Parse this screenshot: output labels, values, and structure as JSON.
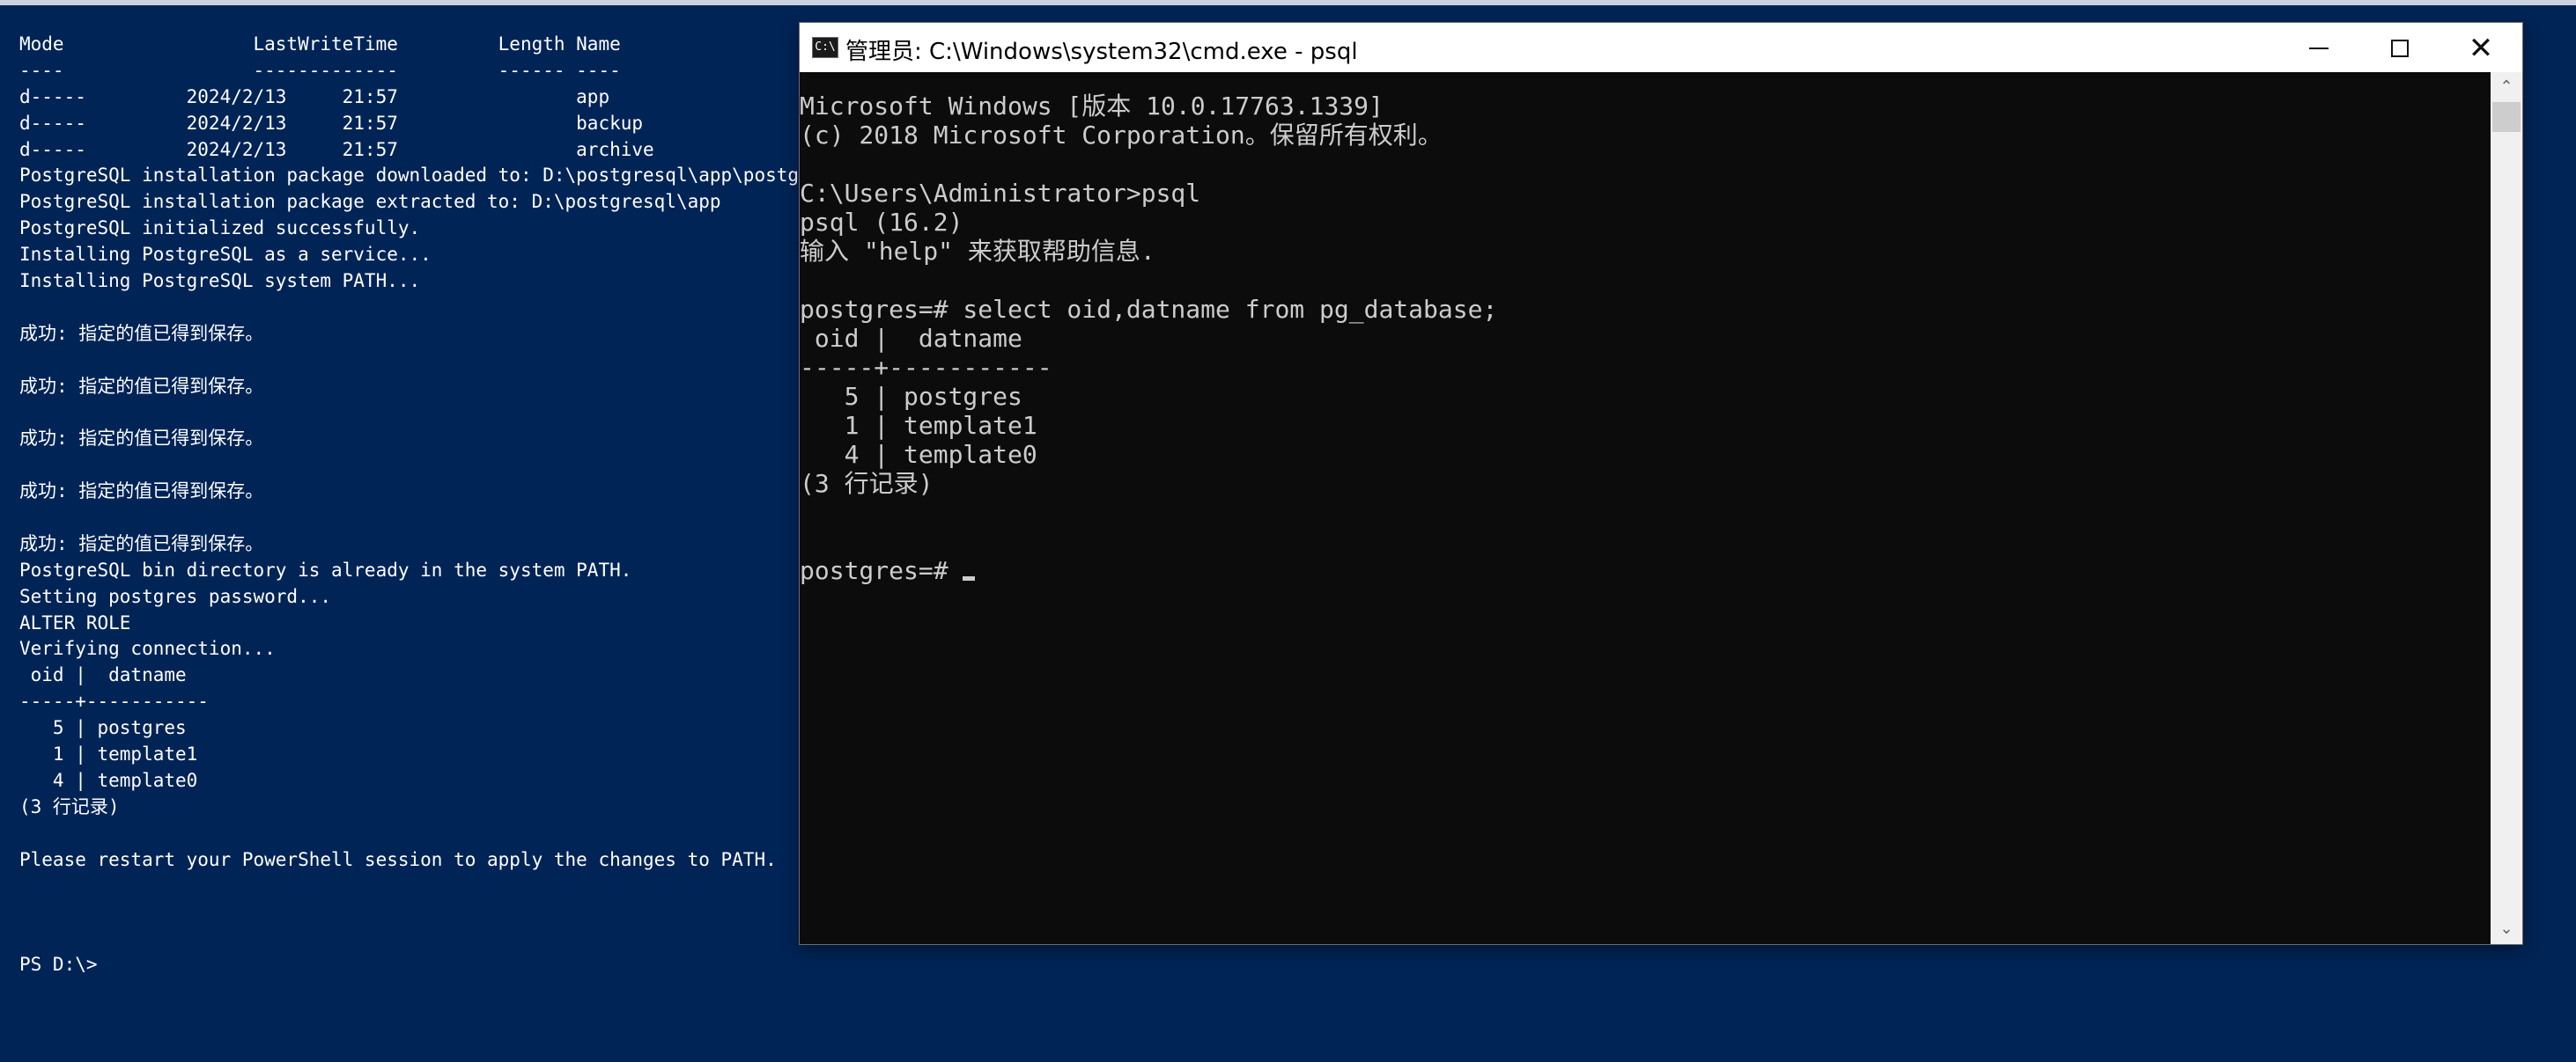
{
  "powershell": {
    "lines": [
      "Mode                 LastWriteTime         Length Name",
      "----                 -------------         ------ ----",
      "d-----         2024/2/13     21:57                app",
      "d-----         2024/2/13     21:57                backup",
      "d-----         2024/2/13     21:57                archive",
      "PostgreSQL installation package downloaded to: D:\\postgresql\\app\\postgres",
      "PostgreSQL installation package extracted to: D:\\postgresql\\app",
      "PostgreSQL initialized successfully.",
      "Installing PostgreSQL as a service...",
      "Installing PostgreSQL system PATH...",
      "",
      "成功: 指定的值已得到保存。",
      "",
      "成功: 指定的值已得到保存。",
      "",
      "成功: 指定的值已得到保存。",
      "",
      "成功: 指定的值已得到保存。",
      "",
      "成功: 指定的值已得到保存。",
      "PostgreSQL bin directory is already in the system PATH.",
      "Setting postgres password...",
      "ALTER ROLE",
      "Verifying connection...",
      " oid |  datname",
      "-----+-----------",
      "   5 | postgres",
      "   1 | template1",
      "   4 | template0",
      "(3 行记录)",
      "",
      "Please restart your PowerShell session to apply the changes to PATH.",
      "",
      "",
      "",
      "PS D:\\>"
    ]
  },
  "cmd": {
    "icon_name": "cmd-app-icon",
    "icon_glyph": "C:\\",
    "title": "管理员: C:\\Windows\\system32\\cmd.exe - psql",
    "minimize_icon": "minimize-icon",
    "maximize_icon": "maximize-icon",
    "close_icon": "close-icon",
    "close_glyph": "✕",
    "lines": [
      "Microsoft Windows [版本 10.0.17763.1339]",
      "(c) 2018 Microsoft Corporation。保留所有权利。",
      "",
      "C:\\Users\\Administrator>psql",
      "psql (16.2)",
      "输入 \"help\" 来获取帮助信息.",
      "",
      "postgres=# select oid,datname from pg_database;",
      " oid |  datname",
      "-----+-----------",
      "   5 | postgres",
      "   1 | template1",
      "   4 | template0",
      "(3 行记录)",
      "",
      "",
      "postgres=# "
    ],
    "scroll_up_glyph": "⌃",
    "scroll_down_glyph": "⌄"
  }
}
